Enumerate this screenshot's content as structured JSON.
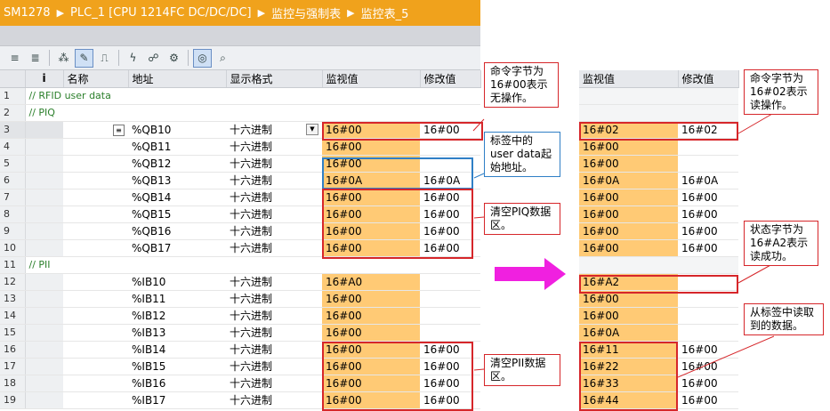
{
  "breadcrumb": [
    "SM1278",
    "PLC_1 [CPU 1214FC DC/DC/DC]",
    "监控与强制表",
    "监控表_5"
  ],
  "breadcrumb_separator": "▶",
  "toolbar_icons": [
    "insert-row-icon",
    "add-row-icon",
    "update-icon",
    "monitor-once-icon",
    "stop-icon",
    "force-icon",
    "unforce-icon",
    "modify-icon",
    "show-all-icon",
    "monitor-all-icon",
    "monitor-icon"
  ],
  "columns": {
    "index": "i",
    "name": "名称",
    "address": "地址",
    "format": "显示格式",
    "monitor": "监视值",
    "modify": "修改值"
  },
  "left_rows": [
    {
      "n": "1",
      "group": "// RFID user data"
    },
    {
      "n": "2",
      "group": "// PIQ"
    },
    {
      "n": "3",
      "addr": "%QB10",
      "fmt": "十六进制",
      "mon": "16#00",
      "mod": "16#00",
      "selected": true
    },
    {
      "n": "4",
      "addr": "%QB11",
      "fmt": "十六进制",
      "mon": "16#00",
      "mod": ""
    },
    {
      "n": "5",
      "addr": "%QB12",
      "fmt": "十六进制",
      "mon": "16#00",
      "mod": ""
    },
    {
      "n": "6",
      "addr": "%QB13",
      "fmt": "十六进制",
      "mon": "16#0A",
      "mod": "16#0A"
    },
    {
      "n": "7",
      "addr": "%QB14",
      "fmt": "十六进制",
      "mon": "16#00",
      "mod": "16#00"
    },
    {
      "n": "8",
      "addr": "%QB15",
      "fmt": "十六进制",
      "mon": "16#00",
      "mod": "16#00"
    },
    {
      "n": "9",
      "addr": "%QB16",
      "fmt": "十六进制",
      "mon": "16#00",
      "mod": "16#00"
    },
    {
      "n": "10",
      "addr": "%QB17",
      "fmt": "十六进制",
      "mon": "16#00",
      "mod": "16#00"
    },
    {
      "n": "11",
      "group": "// PII"
    },
    {
      "n": "12",
      "addr": "%IB10",
      "fmt": "十六进制",
      "mon": "16#A0",
      "mod": ""
    },
    {
      "n": "13",
      "addr": "%IB11",
      "fmt": "十六进制",
      "mon": "16#00",
      "mod": ""
    },
    {
      "n": "14",
      "addr": "%IB12",
      "fmt": "十六进制",
      "mon": "16#00",
      "mod": ""
    },
    {
      "n": "15",
      "addr": "%IB13",
      "fmt": "十六进制",
      "mon": "16#00",
      "mod": ""
    },
    {
      "n": "16",
      "addr": "%IB14",
      "fmt": "十六进制",
      "mon": "16#00",
      "mod": "16#00"
    },
    {
      "n": "17",
      "addr": "%IB15",
      "fmt": "十六进制",
      "mon": "16#00",
      "mod": "16#00"
    },
    {
      "n": "18",
      "addr": "%IB16",
      "fmt": "十六进制",
      "mon": "16#00",
      "mod": "16#00"
    },
    {
      "n": "19",
      "addr": "%IB17",
      "fmt": "十六进制",
      "mon": "16#00",
      "mod": "16#00"
    }
  ],
  "right_rows": [
    {
      "blank": true
    },
    {
      "blank": true
    },
    {
      "mon": "16#02",
      "mod": "16#02"
    },
    {
      "mon": "16#00",
      "mod": ""
    },
    {
      "mon": "16#00",
      "mod": ""
    },
    {
      "mon": "16#0A",
      "mod": "16#0A"
    },
    {
      "mon": "16#00",
      "mod": "16#00"
    },
    {
      "mon": "16#00",
      "mod": "16#00"
    },
    {
      "mon": "16#00",
      "mod": "16#00"
    },
    {
      "mon": "16#00",
      "mod": "16#00"
    },
    {
      "blank": true
    },
    {
      "mon": "16#A2",
      "mod": ""
    },
    {
      "mon": "16#00",
      "mod": ""
    },
    {
      "mon": "16#00",
      "mod": ""
    },
    {
      "mon": "16#0A",
      "mod": ""
    },
    {
      "mon": "16#11",
      "mod": "16#00"
    },
    {
      "mon": "16#22",
      "mod": "16#00"
    },
    {
      "mon": "16#33",
      "mod": "16#00"
    },
    {
      "mon": "16#44",
      "mod": "16#00"
    }
  ],
  "callouts": {
    "cmd_left": "命令字节为16#00表示无操作。",
    "start_addr": "标签中的user data起始地址。",
    "clear_piq": "清空PIQ数据区。",
    "clear_pii": "清空PII数据区。",
    "cmd_right": "命令字节为16#02表示读操作。",
    "status": "状态字节为16#A2表示读成功。",
    "read_data": "从标签中读取到的数据。"
  },
  "colors": {
    "title_bg": "#f0a21c",
    "monitor_fill": "#ffca75",
    "annotation_red": "#d6262a",
    "annotation_blue": "#2f7fc6",
    "arrow_magenta": "#f020e0"
  }
}
